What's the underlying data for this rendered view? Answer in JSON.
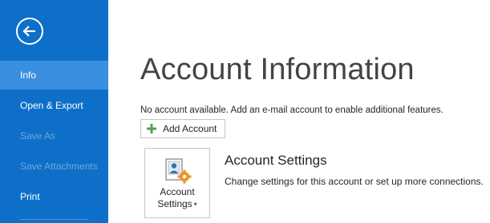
{
  "sidebar": {
    "items": [
      {
        "label": "Info"
      },
      {
        "label": "Open & Export"
      },
      {
        "label": "Save As"
      },
      {
        "label": "Save Attachments"
      },
      {
        "label": "Print"
      }
    ]
  },
  "main": {
    "title": "Account Information",
    "notice": "No account available. Add an e-mail account to enable additional features.",
    "add_account_label": "Add Account",
    "settings_tile": {
      "line1": "Account",
      "line2": "Settings",
      "caret": "▾"
    },
    "section_title": "Account Settings",
    "section_desc": "Change settings for this account or set up more connections."
  },
  "colors": {
    "sidebar": "#0e6fc8",
    "selected": "#3a8fe0",
    "disabled_text": "#6ea7de",
    "plus_icon": "#5b9b5b"
  },
  "icons": {
    "back": "back-arrow-icon",
    "add": "plus-icon",
    "settings": "account-settings-icon"
  }
}
